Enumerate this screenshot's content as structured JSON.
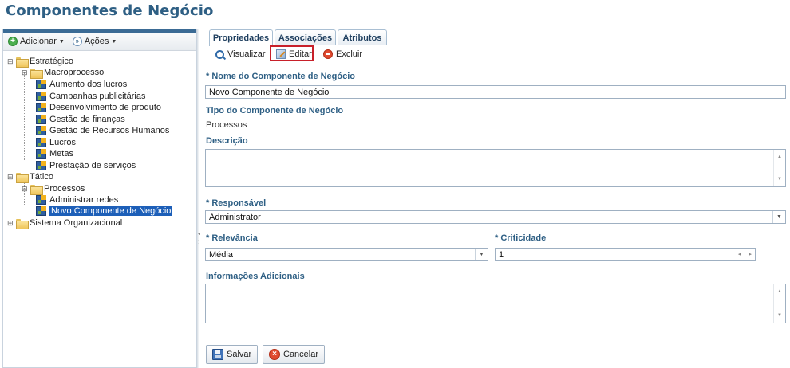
{
  "page": {
    "title": "Componentes de Negócio"
  },
  "left_toolbar": {
    "add_label": "Adicionar",
    "actions_label": "Ações"
  },
  "tree": {
    "nodes": [
      {
        "label": "Estratégico",
        "type": "folder"
      },
      {
        "label": "Macroprocesso",
        "type": "folder"
      },
      {
        "label": "Aumento dos lucros",
        "type": "component"
      },
      {
        "label": "Campanhas publicitárias",
        "type": "component"
      },
      {
        "label": "Desenvolvimento de produto",
        "type": "component"
      },
      {
        "label": "Gestão de finanças",
        "type": "component"
      },
      {
        "label": "Gestão de Recursos Humanos",
        "type": "component"
      },
      {
        "label": "Lucros",
        "type": "component"
      },
      {
        "label": "Metas",
        "type": "component"
      },
      {
        "label": "Prestação de serviços",
        "type": "component"
      },
      {
        "label": "Tático",
        "type": "folder"
      },
      {
        "label": "Processos",
        "type": "folder"
      },
      {
        "label": "Administrar redes",
        "type": "component"
      },
      {
        "label": "Novo Componente de Negócio",
        "type": "component",
        "selected": true
      },
      {
        "label": "Sistema Organizacional",
        "type": "folder"
      }
    ]
  },
  "tabs": [
    {
      "label": "Propriedades",
      "active": true
    },
    {
      "label": "Associações",
      "active": false
    },
    {
      "label": "Atributos",
      "active": false
    }
  ],
  "actions": {
    "view": "Visualizar",
    "edit": "Editar",
    "delete": "Excluir"
  },
  "form": {
    "name_label": "* Nome do Componente de Negócio",
    "name_value": "Novo Componente de Negócio",
    "type_label": "Tipo do Componente de Negócio",
    "type_value": "Processos",
    "description_label": "Descrição",
    "responsible_label": "* Responsável",
    "responsible_value": "Administrator",
    "relevance_label": "* Relevância",
    "relevance_value": "Média",
    "criticality_label": "* Criticidade",
    "criticality_value": "1",
    "additional_info_label": "Informações Adicionais"
  },
  "buttons": {
    "save": "Salvar",
    "cancel": "Cancelar"
  },
  "colors": {
    "accent": "#2e5f84",
    "selection": "#1d5fb8",
    "highlight_border": "#c8202a"
  }
}
